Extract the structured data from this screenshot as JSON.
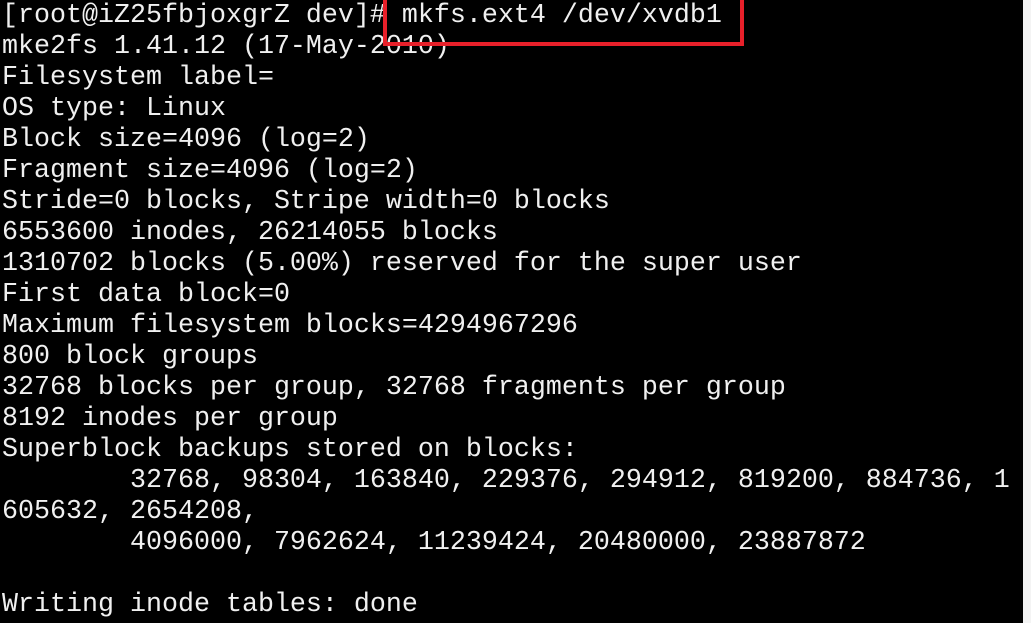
{
  "terminal": {
    "prompt": "[root@iZ25fbjoxgrZ dev]# ",
    "command": "mkfs.ext4 /dev/xvdb1",
    "output": [
      "mke2fs 1.41.12 (17-May-2010)",
      "Filesystem label=",
      "OS type: Linux",
      "Block size=4096 (log=2)",
      "Fragment size=4096 (log=2)",
      "Stride=0 blocks, Stripe width=0 blocks",
      "6553600 inodes, 26214055 blocks",
      "1310702 blocks (5.00%) reserved for the super user",
      "First data block=0",
      "Maximum filesystem blocks=4294967296",
      "800 block groups",
      "32768 blocks per group, 32768 fragments per group",
      "8192 inodes per group",
      "Superblock backups stored on blocks:",
      "        32768, 98304, 163840, 229376, 294912, 819200, 884736, 1",
      "605632, 2654208,",
      "        4096000, 7962624, 11239424, 20480000, 23887872",
      "",
      "Writing inode tables: done"
    ],
    "highlight_color": "#e8202a"
  }
}
